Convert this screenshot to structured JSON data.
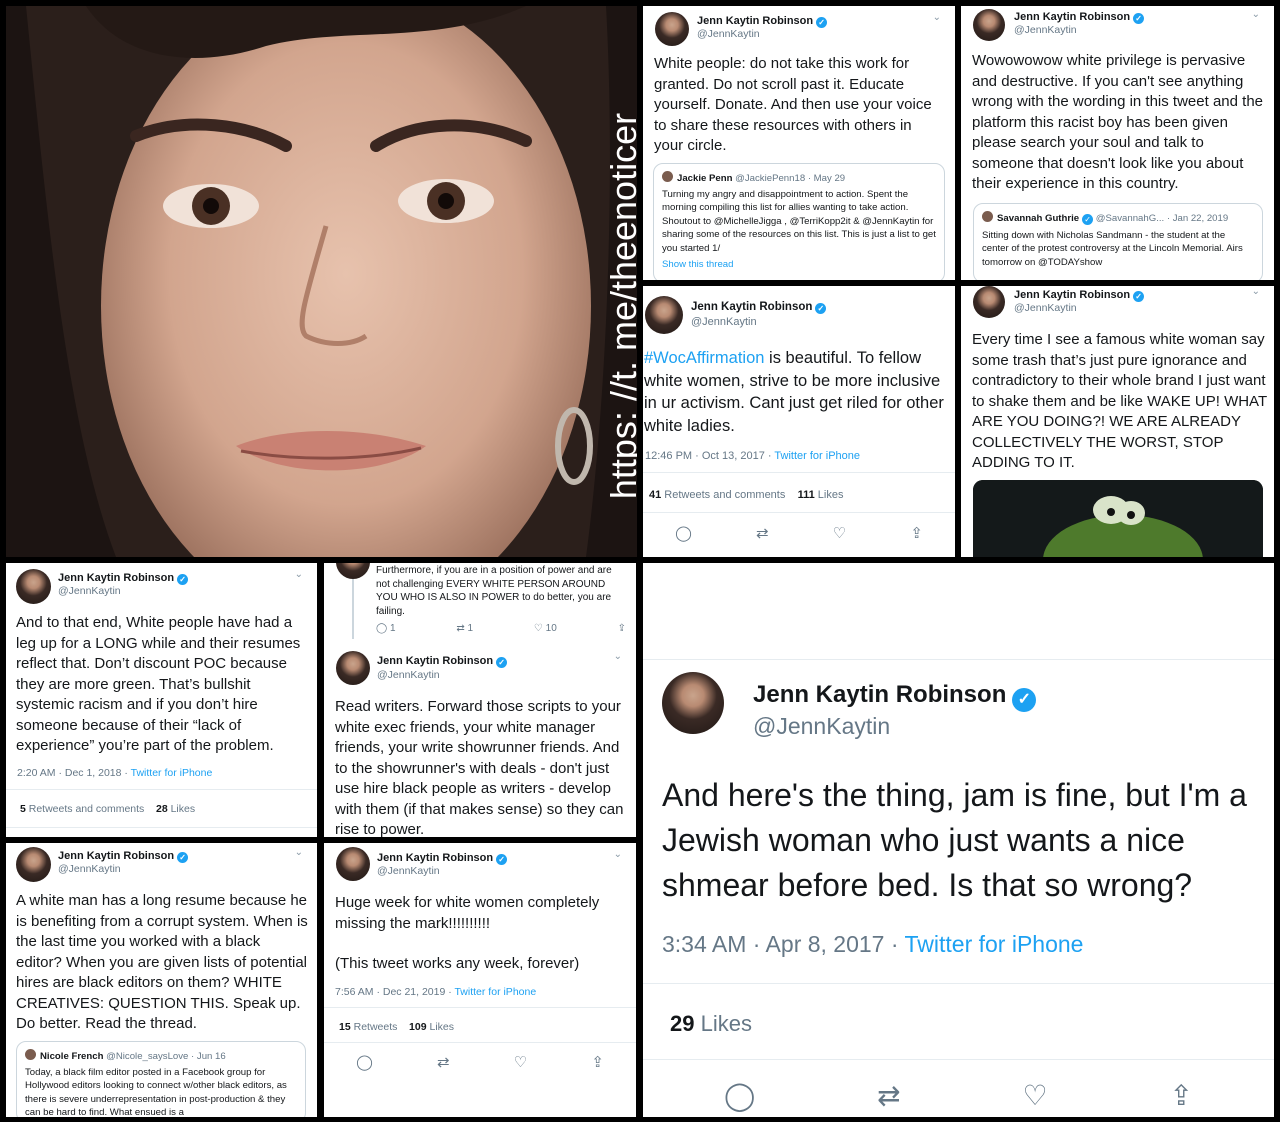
{
  "photo": {
    "watermark": "https: //t. me/theenoticer"
  },
  "tweet_a": {
    "name": "Jenn Kaytin Robinson",
    "handle": "@JennKaytin",
    "text": "White people: do not take this work for granted. Do not scroll past it. Educate yourself. Donate. And then use your voice to share these resources with others in your circle.",
    "quote": {
      "name": "Jackie Penn",
      "handle_date": "@JackiePenn18 · May 29",
      "text": "Turning my angry and disappointment to action. Spent the morning compiling this list for allies wanting to take action. Shoutout to @MichelleJigga , @TerriKopp2it  & @JennKaytin for sharing some of the resources on this list. This is just a list to get you started 1/",
      "show_thread": "Show this thread"
    }
  },
  "tweet_b": {
    "name": "Jenn Kaytin Robinson",
    "handle": "@JennKaytin",
    "text": "Wowowowow white privilege is pervasive and destructive. If you can't see anything wrong with the wording in this tweet and the platform this racist boy has been given please search your soul and talk to someone that doesn't look like you about their experience in this country.",
    "quote": {
      "name": "Savannah Guthrie",
      "handle_date": "@SavannahG... · Jan 22, 2019",
      "text": "Sitting down with Nicholas Sandmann - the student at the center of the protest controversy at the Lincoln Memorial. Airs tomorrow on @TODAYshow"
    }
  },
  "tweet_c": {
    "name": "Jenn Kaytin Robinson",
    "handle": "@JennKaytin",
    "hashtag": "#WocAffirmation",
    "text": " is beautiful. To fellow white women, strive to be more inclusive in ur activism. Cant just get riled for other white ladies.",
    "time": "12:46 PM · Oct 13, 2017 · ",
    "source": "Twitter for iPhone",
    "retweets": "41",
    "retweets_label": " Retweets and comments",
    "likes": "111",
    "likes_label": " Likes"
  },
  "tweet_d": {
    "name": "Jenn Kaytin Robinson",
    "handle": "@JennKaytin",
    "text": "Every time I see a famous white woman say some trash that’s just pure ignorance and contradictory to their whole brand I just want to shake them and be like WAKE UP! WHAT ARE YOU DOING?! WE ARE ALREADY COLLECTIVELY THE WORST, STOP ADDING TO IT."
  },
  "tweet_e": {
    "name": "Jenn Kaytin Robinson",
    "handle": "@JennKaytin",
    "text": "And to that end, White people have had a leg up for a LONG while and their resumes reflect that. Don’t discount POC because they are more green. That’s bullshit systemic racism and if you don’t hire someone because of their “lack of experience” you’re part of the problem.",
    "time": "2:20 AM · Dec 1, 2018 · ",
    "source": "Twitter for iPhone",
    "retweets": "5",
    "retweets_label": " Retweets and comments",
    "likes": "28",
    "likes_label": " Likes"
  },
  "tweet_f": {
    "prev_text": "Furthermore, if you are in a position of power and are not challenging EVERY WHITE PERSON AROUND YOU WHO IS ALSO IN POWER to do better, you are failing.",
    "prev_replies": "1",
    "prev_retweets": "1",
    "prev_likes": "10",
    "name": "Jenn Kaytin Robinson",
    "handle": "@JennKaytin",
    "text": "Read writers. Forward those scripts to your white exec friends, your white manager friends, your write showrunner friends. And to the showrunner's with deals - don't just use hire black people as writers - develop with them (if that makes sense) so they can rise to power."
  },
  "tweet_g": {
    "name": "Jenn Kaytin Robinson",
    "handle": "@JennKaytin",
    "text": "A white man has a long resume because he is benefiting from a corrupt system. When is the last time you worked with a black editor? When you are given lists of potential hires are black editors on them? WHITE CREATIVES: QUESTION THIS. Speak up. Do better. Read the thread.",
    "quote": {
      "name": "Nicole French",
      "handle_date": "@Nicole_saysLove · Jun 16",
      "text": "Today, a black film editor posted in a Facebook group for Hollywood editors looking to connect w/other black editors, as there is severe underrepresentation in post-production & they can be hard to find.  What ensued is a"
    }
  },
  "tweet_h": {
    "name": "Jenn Kaytin Robinson",
    "handle": "@JennKaytin",
    "text": "Huge week for white women completely missing the mark!!!!!!!!!!",
    "text2": "(This tweet works any week, forever)",
    "time": "7:56 AM · Dec 21, 2019 · ",
    "source": "Twitter for iPhone",
    "retweets": "15",
    "retweets_label": " Retweets",
    "likes": "109",
    "likes_label": " Likes"
  },
  "tweet_i": {
    "name": "Jenn Kaytin Robinson",
    "handle": "@JennKaytin",
    "text": "And here's the thing, jam is fine, but I'm a Jewish woman who just wants a nice shmear before bed. Is that so wrong?",
    "time": "3:34 AM · Apr 8, 2017 · ",
    "source": "Twitter for iPhone",
    "likes": "29",
    "likes_label": " Likes"
  },
  "icons": [
    "reply-icon",
    "retweet-icon",
    "like-icon",
    "share-icon",
    "verified-icon",
    "chevron-down-icon"
  ],
  "colors": {
    "twitter_blue": "#1da1f2",
    "muted": "#657786",
    "border": "#000000"
  }
}
